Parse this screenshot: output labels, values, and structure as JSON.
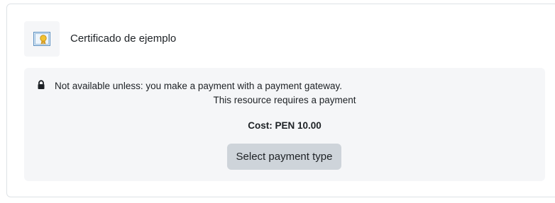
{
  "activity": {
    "icon": "certificate-icon",
    "title": "Certificado de ejemplo"
  },
  "restriction": {
    "icon": "lock-icon",
    "message": "Not available unless: you make a payment with a payment gateway.",
    "requires": "This resource requires a payment",
    "cost_label": "Cost:",
    "cost_currency": "PEN",
    "cost_amount": "10.00",
    "cost_text": "Cost: PEN 10.00",
    "button_label": "Select payment type"
  },
  "colors": {
    "restriction_bg": "#f5f6f8",
    "button_bg": "#ced4da",
    "text": "#1d2125",
    "border": "#dee2e6"
  }
}
